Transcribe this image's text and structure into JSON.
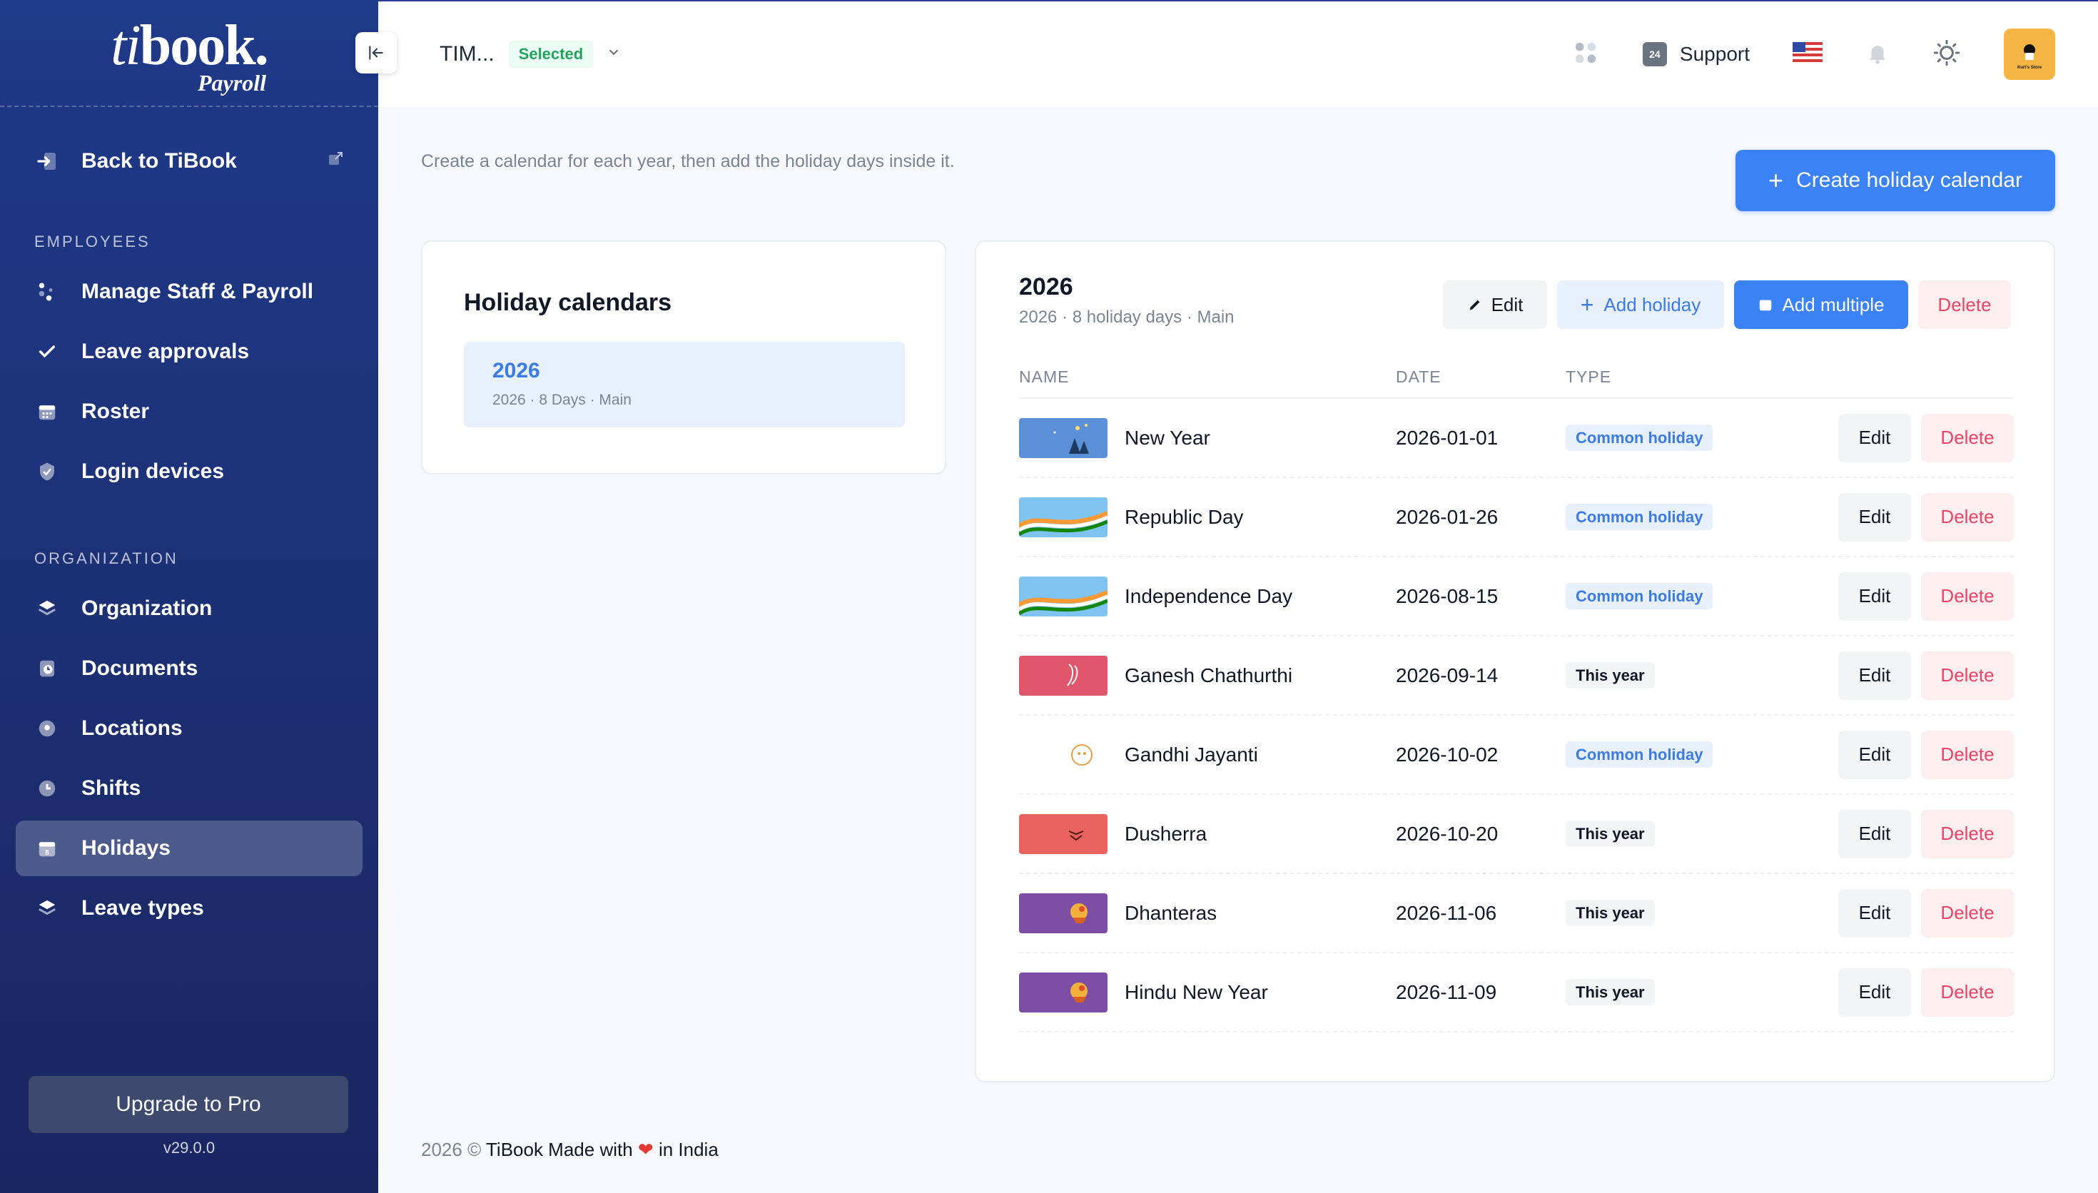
{
  "brand": {
    "logo_ti": "ti",
    "logo_book": "book.",
    "logo_sub": "Payroll"
  },
  "sidebar": {
    "back_label": "Back to TiBook",
    "section_employees": "EMPLOYEES",
    "employees_items": [
      {
        "label": "Manage Staff & Payroll",
        "icon": "staff-icon"
      },
      {
        "label": "Leave approvals",
        "icon": "check-icon"
      },
      {
        "label": "Roster",
        "icon": "calendar-grid-icon"
      },
      {
        "label": "Login devices",
        "icon": "shield-check-icon"
      }
    ],
    "section_org": "ORGANIZATION",
    "org_items": [
      {
        "label": "Organization",
        "icon": "layers-icon"
      },
      {
        "label": "Documents",
        "icon": "document-clock-icon"
      },
      {
        "label": "Locations",
        "icon": "pin-icon"
      },
      {
        "label": "Shifts",
        "icon": "clock-icon"
      },
      {
        "label": "Holidays",
        "icon": "calendar-icon",
        "active": true
      },
      {
        "label": "Leave types",
        "icon": "layers-icon"
      }
    ],
    "upgrade_label": "Upgrade to Pro",
    "version": "v29.0.0"
  },
  "topbar": {
    "company": "TIM...",
    "selected_badge": "Selected",
    "support_badge": "24",
    "support_label": "Support",
    "avatar_text": "Kurt's Store"
  },
  "main": {
    "intro": "Create a calendar for each year, then add the holiday days inside it.",
    "create_button": "Create holiday calendar",
    "calendars_title": "Holiday calendars",
    "calendars": [
      {
        "year": "2026",
        "summary": "2026 · 8 Days · Main"
      }
    ],
    "detail": {
      "title": "2026",
      "subtitle": "2026 · 8 holiday days · Main",
      "edit_label": "Edit",
      "add_holiday_label": "Add holiday",
      "add_multiple_label": "Add multiple",
      "delete_label": "Delete",
      "columns": [
        "NAME",
        "DATE",
        "TYPE"
      ],
      "rows": [
        {
          "name": "New Year",
          "date": "2026-01-01",
          "type": "Common holiday",
          "kind": "common",
          "thumb": "new-year"
        },
        {
          "name": "Republic Day",
          "date": "2026-01-26",
          "type": "Common holiday",
          "kind": "common",
          "thumb": "flag"
        },
        {
          "name": "Independence Day",
          "date": "2026-08-15",
          "type": "Common holiday",
          "kind": "common",
          "thumb": "flag"
        },
        {
          "name": "Ganesh Chathurthi",
          "date": "2026-09-14",
          "type": "This year",
          "kind": "year",
          "thumb": "ganesh"
        },
        {
          "name": "Gandhi Jayanti",
          "date": "2026-10-02",
          "type": "Common holiday",
          "kind": "common",
          "thumb": "gandhi"
        },
        {
          "name": "Dusherra",
          "date": "2026-10-20",
          "type": "This year",
          "kind": "year",
          "thumb": "durga"
        },
        {
          "name": "Dhanteras",
          "date": "2026-11-06",
          "type": "This year",
          "kind": "year",
          "thumb": "diya"
        },
        {
          "name": "Hindu New Year",
          "date": "2026-11-09",
          "type": "This year",
          "kind": "year",
          "thumb": "diya"
        }
      ],
      "row_edit": "Edit",
      "row_delete": "Delete"
    },
    "footer": {
      "year": "2026 ©",
      "text": "TiBook Made with",
      "suffix": "in India"
    }
  },
  "colors": {
    "primary": "#3b82f6",
    "danger": "#ef4465",
    "sidebar": "#1f3a8a",
    "success": "#22a45d"
  }
}
